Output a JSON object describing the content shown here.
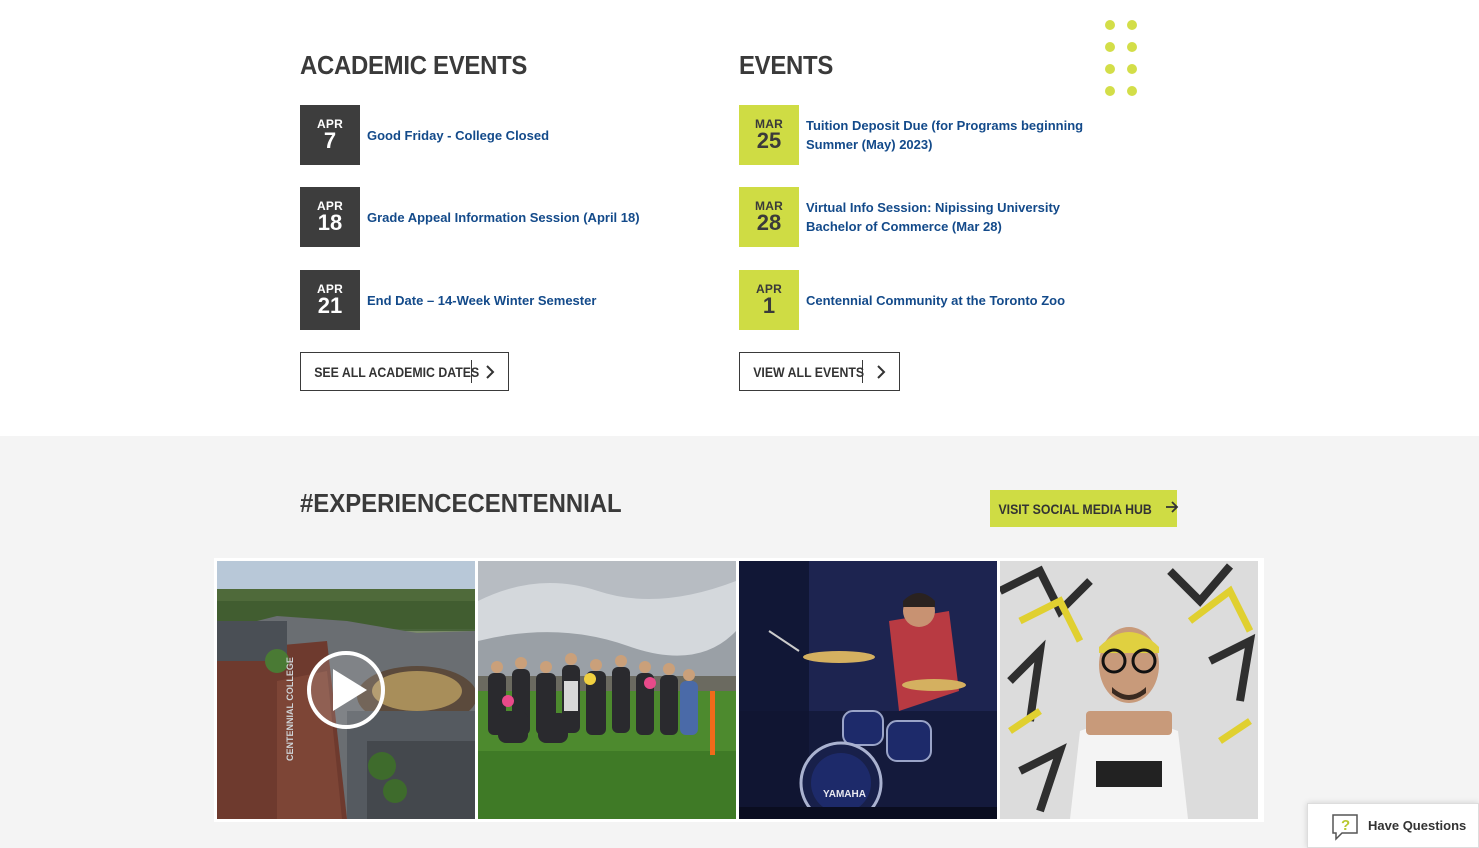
{
  "academic": {
    "title": "ACADEMIC EVENTS",
    "events": [
      {
        "month": "APR",
        "day": "7",
        "title": "Good Friday - College Closed"
      },
      {
        "month": "APR",
        "day": "18",
        "title": "Grade Appeal Information Session (April 18)"
      },
      {
        "month": "APR",
        "day": "21",
        "title": "End Date – 14-Week Winter Semester"
      }
    ],
    "button_label": "SEE ALL ACADEMIC DATES"
  },
  "events": {
    "title": "EVENTS",
    "events": [
      {
        "month": "MAR",
        "day": "25",
        "title": "Tuition Deposit Due (for Programs beginning Summer (May) 2023)"
      },
      {
        "month": "MAR",
        "day": "28",
        "title": "Virtual Info Session: Nipissing University Bachelor of Commerce (Mar 28)"
      },
      {
        "month": "APR",
        "day": "1",
        "title": "Centennial Community at the Toronto Zoo"
      }
    ],
    "button_label": "VIEW ALL EVENTS"
  },
  "social": {
    "title": "#EXPERIENCECENTENNIAL",
    "hub_button": "VISIT SOCIAL MEDIA HUB",
    "tiles": [
      {
        "icon": "campus-aerial-video",
        "building_text": "CENTENNIAL COLLEGE"
      },
      {
        "icon": "group-photo"
      },
      {
        "icon": "drummer-photo",
        "drum_text": "YAMAHA"
      },
      {
        "icon": "portrait-photo"
      }
    ]
  },
  "help": {
    "label": "Have Questions"
  },
  "colors": {
    "lime": "#cfdc44",
    "dark": "#3d3d3d",
    "link": "#134a8a"
  }
}
